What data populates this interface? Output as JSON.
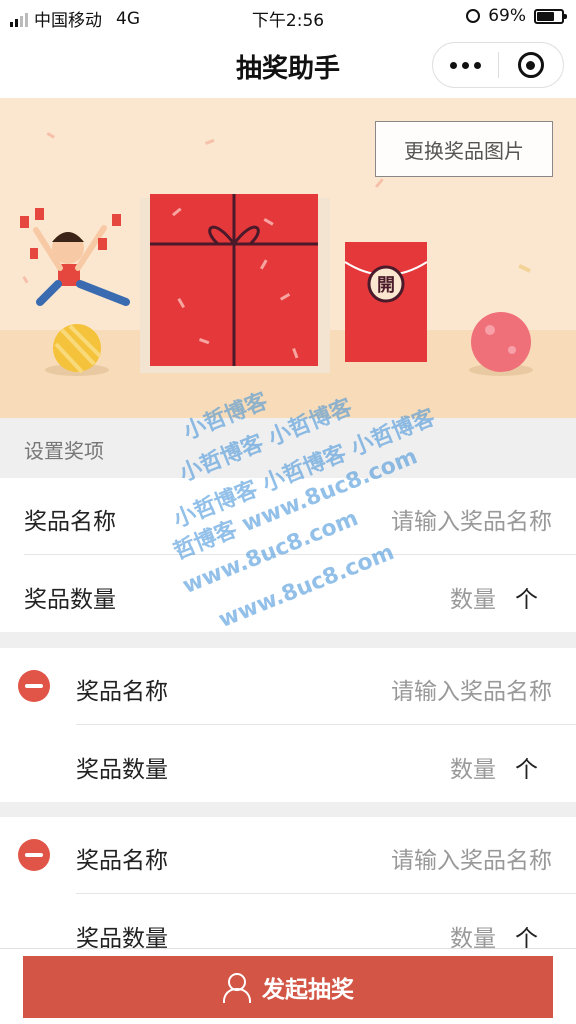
{
  "status_bar": {
    "carrier": "中国移动",
    "network": "4G",
    "time": "下午2:56",
    "battery": "69%",
    "battery_level": 0.69
  },
  "nav": {
    "title": "抽奖助手",
    "more_icon": "more-dots-icon",
    "close_icon": "target-circle-icon"
  },
  "banner": {
    "change_image_label": "更换奖品图片",
    "red_packet_char": "開"
  },
  "section": {
    "title": "设置奖项"
  },
  "prizes": [
    {
      "name_label": "奖品名称",
      "name_placeholder": "请输入奖品名称",
      "qty_label": "奖品数量",
      "qty_placeholder": "数量",
      "unit": "个"
    },
    {
      "name_label": "奖品名称",
      "name_placeholder": "请输入奖品名称",
      "qty_label": "奖品数量",
      "qty_placeholder": "数量",
      "unit": "个"
    },
    {
      "name_label": "奖品名称",
      "name_placeholder": "请输入奖品名称",
      "qty_label": "奖品数量",
      "qty_placeholder": "数量",
      "unit": "个"
    }
  ],
  "action": {
    "start_label": "发起抽奖",
    "icon": "user-icon"
  },
  "watermark": [
    "小哲博客",
    "小哲博客 小哲博客",
    "小哲博客 小哲博客 小哲博客",
    "哲博客 www.8uc8.com",
    "www.8uc8.com",
    "www.8uc8.com"
  ],
  "colors": {
    "accent": "#d35545",
    "remove": "#e05548",
    "banner_bg": "#fbe7cf"
  }
}
